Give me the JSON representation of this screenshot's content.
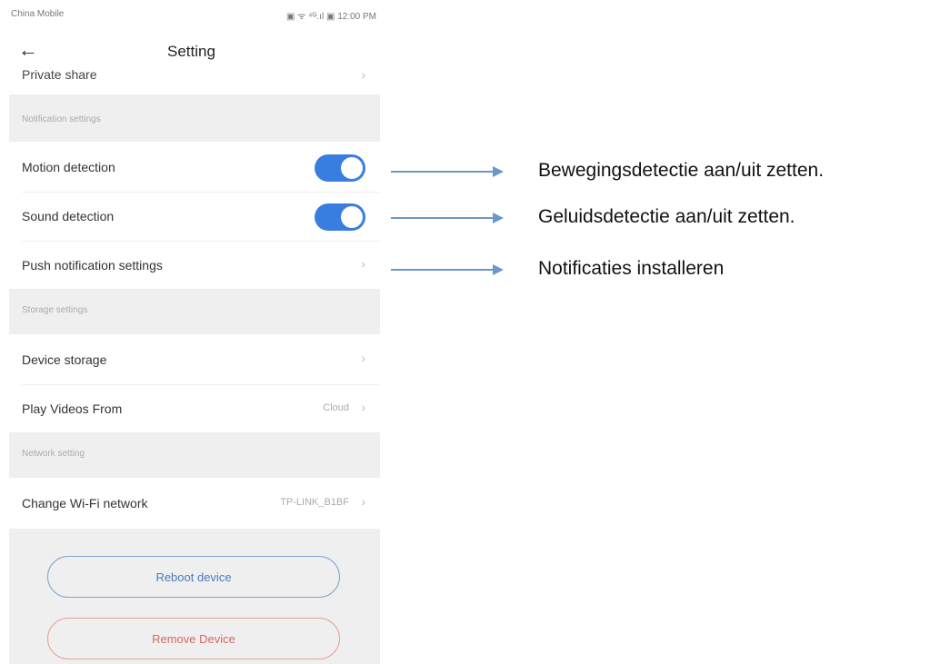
{
  "status_bar": {
    "carrier": "China Mobile",
    "right": "▣ ᯤ ⁴ᴳ.ıl ▣ 12:00 PM"
  },
  "header": {
    "title": "Setting"
  },
  "cutoff_row": {
    "label": "Private share"
  },
  "sections": {
    "notification": "Notification settings",
    "storage": "Storage settings",
    "network": "Network setting"
  },
  "rows": {
    "motion_detection": {
      "label": "Motion detection",
      "enabled": true
    },
    "sound_detection": {
      "label": "Sound detection",
      "enabled": true
    },
    "push_notification": {
      "label": "Push notification settings"
    },
    "device_storage": {
      "label": "Device storage"
    },
    "play_videos_from": {
      "label": "Play Videos From",
      "value": "Cloud"
    },
    "change_wifi": {
      "label": "Change Wi-Fi network",
      "value": "TP-LINK_B1BF"
    }
  },
  "buttons": {
    "reboot": "Reboot device",
    "remove": "Remove Device"
  },
  "annotations": [
    "Bewegingsdetectie aan/uit zetten.",
    "Geluidsdetectie aan/uit zetten.",
    "Notificaties installeren"
  ],
  "colors": {
    "accent": "#3a7de0",
    "arrow": "#6a98c9",
    "reboot_border": "#7ea2cf",
    "remove_border": "#e3a19b",
    "section_bg": "#efefef"
  }
}
